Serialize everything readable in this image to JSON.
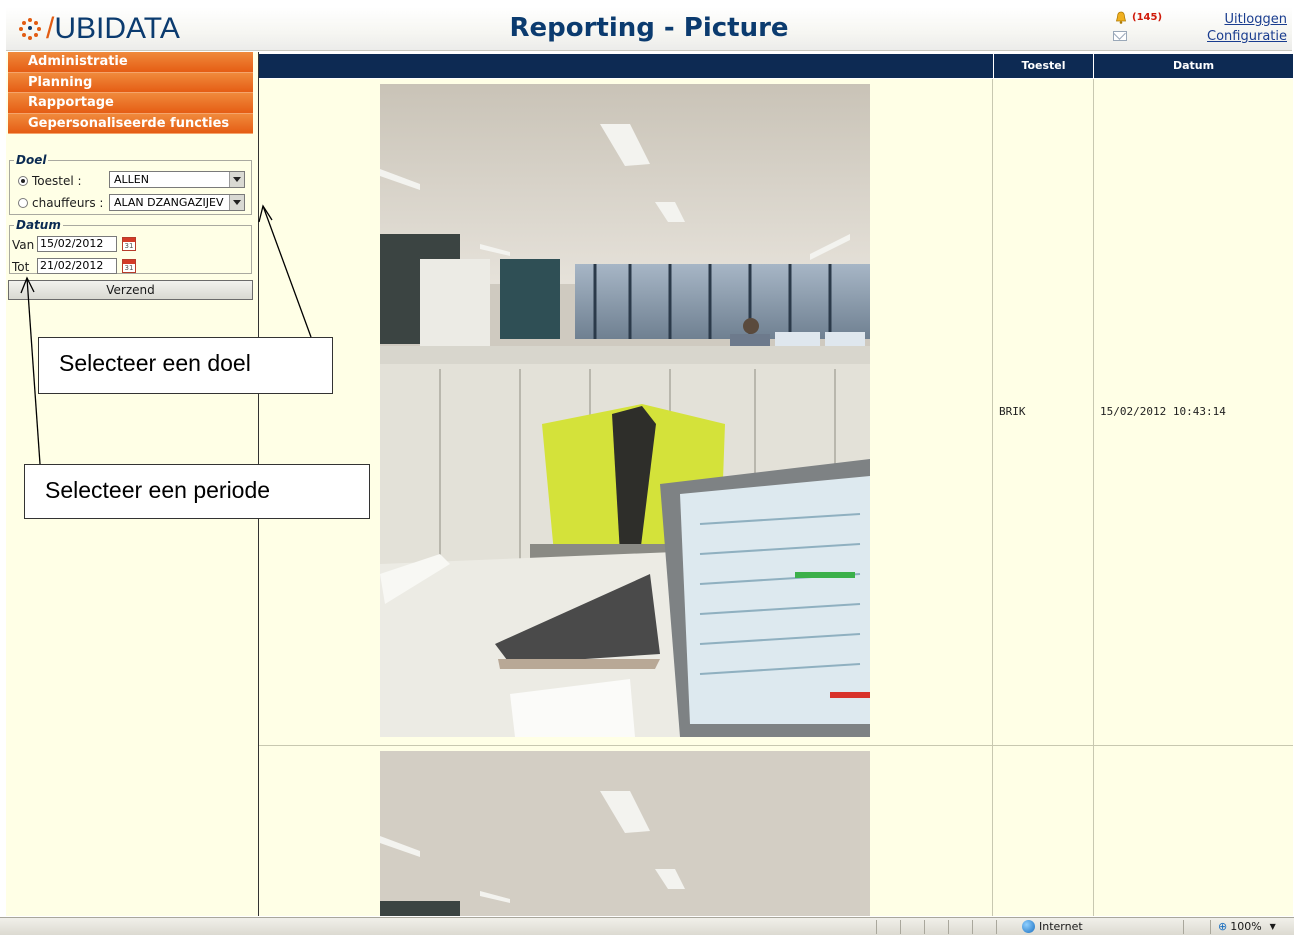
{
  "header": {
    "logo_prefix": "/",
    "logo_text": "UBIDATA",
    "title": "Reporting - Picture",
    "alert_count": "(145)",
    "logout_label": "Uitloggen",
    "config_label": "Configuratie"
  },
  "menu": {
    "items": [
      {
        "label": "Administratie"
      },
      {
        "label": "Planning"
      },
      {
        "label": "Rapportage"
      },
      {
        "label": "Gepersonaliseerde functies"
      }
    ]
  },
  "doel": {
    "legend": "Doel",
    "toestel_label": "Toestel :",
    "toestel_value": "ALLEN",
    "chauffeurs_label": "chauffeurs :",
    "chauffeurs_value": "ALAN DZANGAZIJEV",
    "selected": "toestel"
  },
  "datum": {
    "legend": "Datum",
    "van_label": "Van",
    "van_value": "15/02/2012",
    "tot_label": "Tot",
    "tot_value": "21/02/2012",
    "calendar_day": "31"
  },
  "send_label": "Verzend",
  "callouts": {
    "doel": "Selecteer een doel",
    "periode": "Selecteer een periode"
  },
  "table": {
    "columns": [
      "Toestel",
      "Datum"
    ],
    "rows": [
      {
        "toestel": "BRIK",
        "datum": "15/02/2012 10:43:14"
      },
      {
        "toestel": "",
        "datum": ""
      }
    ]
  },
  "statusbar": {
    "zone": "Internet",
    "zoom": "100%"
  },
  "colors": {
    "accent_orange": "#e55d14",
    "navy": "#0d2a53",
    "panel_bg": "#ffffe6"
  }
}
